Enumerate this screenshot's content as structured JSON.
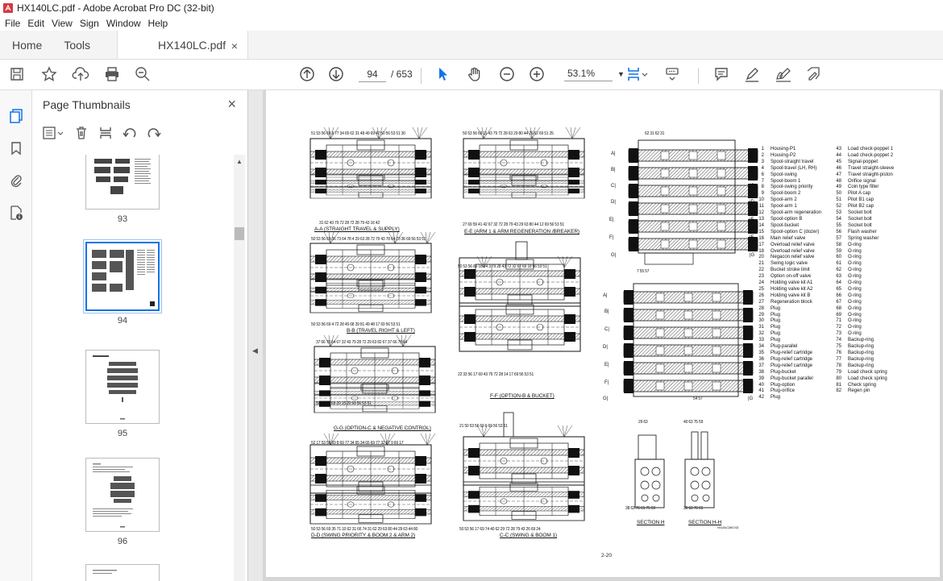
{
  "window": {
    "title": "HX140LC.pdf - Adobe Acrobat Pro DC (32-bit)"
  },
  "menu": [
    "File",
    "Edit",
    "View",
    "Sign",
    "Window",
    "Help"
  ],
  "tabs": {
    "home": "Home",
    "tools": "Tools",
    "doc": "HX140LC.pdf",
    "close": "×"
  },
  "toolbar": {
    "current_page": "94",
    "total_pages": "/ 653",
    "zoom": "53.1%"
  },
  "panel": {
    "title": "Page Thumbnails",
    "close": "×",
    "thumbnails": [
      {
        "label": "93"
      },
      {
        "label": "94",
        "selected": true
      },
      {
        "label": "95"
      },
      {
        "label": "96"
      }
    ]
  },
  "page": {
    "page_number": "2-20",
    "captions": {
      "aa": "A-A (STRAIGHT TRAVEL & SUPPLY)",
      "ee": "E-E (ARM 1 & ARM REGENERATION /BREAKER)",
      "bb": "B-B (TRAVEL RIGHT & LEFT)",
      "ff": "F-F (OPTION-B & BUCKET)",
      "gg": "G-G (OPTION-C & NEGATIVE CONTROL)",
      "dd": "D-D (SWING PRIORITY & BOOM 2 & ARM 2)",
      "cc": "C-C (SWING & BOOM 1)",
      "sh": "SECTION H",
      "shh": "SECTION H-H",
      "code": "HX140LC2MCV32"
    },
    "callouts": {
      "aa_top": "51 53 56 69 9 77 34 65 62 31 48 49 69 47 50 56 53 51 30",
      "aa_bot": "31 62 43 79 72 28 72 28 79 43 16 42",
      "ee_top": "50 53 56 69 11 43 79 72 28 63 29 80 44 26 62 69 51 25",
      "ee_bot": "27 69 59 41 42 67 32 72 28 79 43 29 63 80 44 12 69 56 53 51",
      "r_top": "62 31 62 31",
      "bb_top": "50 53 56 69 36 73 64 78 4 29 63 28 72 79 43 78 64 73 36 69 56 53 51",
      "bb_bot": "50 53 56 69 4 72 28 45 68 39 81 49 48 17 69 56 53 51",
      "ff_top": "50 53 56 69 18 14 3 79 28 43 72 32 67 69 18 56 53 51",
      "ff_bot": "22 33 56 17 69 43 79 72 28 14 17 69 56 53 51",
      "gg_top": "37 66 78 64 67 32 43 79 28 72 29 63 82 67 37 66 78 64",
      "gg_bot": "50 53 56 69 20 15 20 69 56 53 51",
      "dd_top": "52 17 53 56 69 8 69 77 34 65 34 65 69 77 32 67 9 69 17",
      "dd_bot": "50 53 56 69 35 71 10 62 31 66 74 31 62 29 63 80 44 29 63 44 80",
      "cc_top": "21 50 53 56 69 6 69 56 53 51",
      "cc_bot": "50 53 56 17 69 74 40 62 29 72 28 79 43 26 69 24",
      "r2_top": "7 55 57",
      "r2_bot": "54 57",
      "sh_top": "29 63",
      "sh_bot": "38 63 76 61 75 59",
      "shh_top": "40 63 75 59",
      "shh_bot": "39 63 76 61"
    },
    "legend_left": [
      [
        "1",
        "Housing-P1"
      ],
      [
        "2",
        "Housing-P2"
      ],
      [
        "3",
        "Spool-straight travel"
      ],
      [
        "4",
        "Spool-travel (LH, RH)"
      ],
      [
        "6",
        "Spool-swing"
      ],
      [
        "7",
        "Spool-boom 1"
      ],
      [
        "8",
        "Spool-swing priority"
      ],
      [
        "9",
        "Spool-boom 2"
      ],
      [
        "10",
        "Spool-arm 2"
      ],
      [
        "11",
        "Spool-arm 1"
      ],
      [
        "12",
        "Spool-arm regeneration"
      ],
      [
        "13",
        "Spool-option B"
      ],
      [
        "14",
        "Spool-bucket"
      ],
      [
        "15",
        "Spool-option C (dozer)"
      ],
      [
        "16",
        "Main relief valve"
      ],
      [
        "17",
        "Overload relief valve"
      ],
      [
        "18",
        "Overload relief valve"
      ],
      [
        "20",
        "Negacon relief valve"
      ],
      [
        "21",
        "Swing logic valve"
      ],
      [
        "22",
        "Bucket stroke limit"
      ],
      [
        "23",
        "Option on-off valve"
      ],
      [
        "24",
        "Holding valve kit A1"
      ],
      [
        "25",
        "Holding valve kit A2"
      ],
      [
        "26",
        "Holding valve kit B"
      ],
      [
        "27",
        "Regeneration block"
      ],
      [
        "28",
        "Plug"
      ],
      [
        "29",
        "Plug"
      ],
      [
        "30",
        "Plug"
      ],
      [
        "31",
        "Plug"
      ],
      [
        "32",
        "Plug"
      ],
      [
        "33",
        "Plug"
      ],
      [
        "34",
        "Plug-parallel"
      ],
      [
        "35",
        "Plug-relief cartridge"
      ],
      [
        "36",
        "Plug-relief cartridge"
      ],
      [
        "37",
        "Plug-relief cartridge"
      ],
      [
        "38",
        "Plug-bucket"
      ],
      [
        "39",
        "Plug-bucket parallel"
      ],
      [
        "40",
        "Plug-option"
      ],
      [
        "41",
        "Plug-orifice"
      ],
      [
        "42",
        "Plug"
      ]
    ],
    "legend_right": [
      [
        "43",
        "Load check-poppet 1"
      ],
      [
        "44",
        "Load check-poppet 2"
      ],
      [
        "45",
        "Signal-poppet"
      ],
      [
        "46",
        "Travel straight-sleeve"
      ],
      [
        "47",
        "Travel straight-piston"
      ],
      [
        "48",
        "Orifice signal"
      ],
      [
        "49",
        "Coin type filter"
      ],
      [
        "50",
        "Pilot A cap"
      ],
      [
        "51",
        "Pilot B1 cap"
      ],
      [
        "52",
        "Pilot B2 cap"
      ],
      [
        "53",
        "Socket bolt"
      ],
      [
        "54",
        "Socket bolt"
      ],
      [
        "55",
        "Socket bolt"
      ],
      [
        "56",
        "Flash washer"
      ],
      [
        "57",
        "Spring washer"
      ],
      [
        "58",
        "O-ring"
      ],
      [
        "59",
        "O-ring"
      ],
      [
        "60",
        "O-ring"
      ],
      [
        "61",
        "O-ring"
      ],
      [
        "62",
        "O-ring"
      ],
      [
        "63",
        "O-ring"
      ],
      [
        "64",
        "O-ring"
      ],
      [
        "65",
        "O-ring"
      ],
      [
        "66",
        "O-ring"
      ],
      [
        "67",
        "O-ring"
      ],
      [
        "68",
        "O-ring"
      ],
      [
        "69",
        "O-ring"
      ],
      [
        "71",
        "O-ring"
      ],
      [
        "72",
        "O-ring"
      ],
      [
        "73",
        "O-ring"
      ],
      [
        "74",
        "Backup-ring"
      ],
      [
        "75",
        "Backup-ring"
      ],
      [
        "76",
        "Backup-ring"
      ],
      [
        "77",
        "Backup-ring"
      ],
      [
        "78",
        "Backup-ring"
      ],
      [
        "79",
        "Load check spring"
      ],
      [
        "80",
        "Load check spring"
      ],
      [
        "81",
        "Check spring"
      ],
      [
        "82",
        "Regen pin"
      ]
    ]
  },
  "colors": {
    "accent": "#1473e6",
    "brand_red": "#d7373f",
    "selected_border": "#1473e6"
  }
}
